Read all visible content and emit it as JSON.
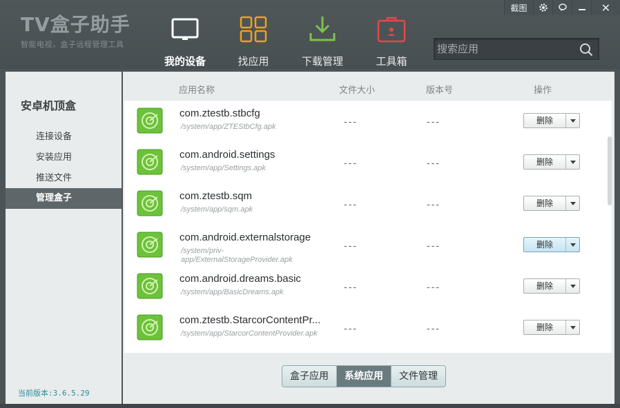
{
  "app": {
    "title": "TV盒子助手",
    "subtitle": "智能电视，盒子远程管理工具"
  },
  "titlebar": {
    "screenshot_label": "截图",
    "close_label": "✕"
  },
  "nav": [
    {
      "label": "我的设备",
      "icon": "tv-icon",
      "active": true
    },
    {
      "label": "找应用",
      "icon": "grid-icon",
      "active": false
    },
    {
      "label": "下载管理",
      "icon": "download-icon",
      "active": false
    },
    {
      "label": "工具箱",
      "icon": "toolbox-icon",
      "active": false
    }
  ],
  "search": {
    "placeholder": "搜索应用"
  },
  "sidebar": {
    "title": "安卓机顶盒",
    "items": [
      {
        "label": "连接设备"
      },
      {
        "label": "安装应用"
      },
      {
        "label": "推送文件"
      },
      {
        "label": "管理盒子",
        "active": true
      }
    ],
    "version": "当前版本:3.6.5.29"
  },
  "table": {
    "headers": {
      "name": "应用名称",
      "size": "文件大小",
      "version": "版本号",
      "action": "操作"
    },
    "rows": [
      {
        "name": "com.ztestb.stbcfg",
        "path": "/system/app/ZTEStbCfg.apk",
        "size": "---",
        "version": "---",
        "action": "删除"
      },
      {
        "name": "com.android.settings",
        "path": "/system/app/Settings.apk",
        "size": "---",
        "version": "---",
        "action": "删除"
      },
      {
        "name": "com.ztestb.sqm",
        "path": "/system/app/sqm.apk",
        "size": "---",
        "version": "---",
        "action": "删除"
      },
      {
        "name": "com.android.externalstorage",
        "path": "/system/priv-app/ExternalStorageProvider.apk",
        "size": "---",
        "version": "---",
        "action": "删除"
      },
      {
        "name": "com.android.dreams.basic",
        "path": "/system/app/BasicDreams.apk",
        "size": "---",
        "version": "---",
        "action": "删除"
      },
      {
        "name": "com.ztestb.StarcorContentPr...",
        "path": "/system/app/StarcorContentProvider.apk",
        "size": "---",
        "version": "---",
        "action": "删除"
      }
    ]
  },
  "tabs": [
    {
      "label": "盒子应用",
      "active": false
    },
    {
      "label": "系统应用",
      "active": true
    },
    {
      "label": "文件管理",
      "active": false
    }
  ],
  "colors": {
    "accent_green": "#5dbb2a",
    "download_green": "#7cc34a",
    "toolbox_red": "#e04a4a",
    "grid_orange": "#f0a020"
  }
}
